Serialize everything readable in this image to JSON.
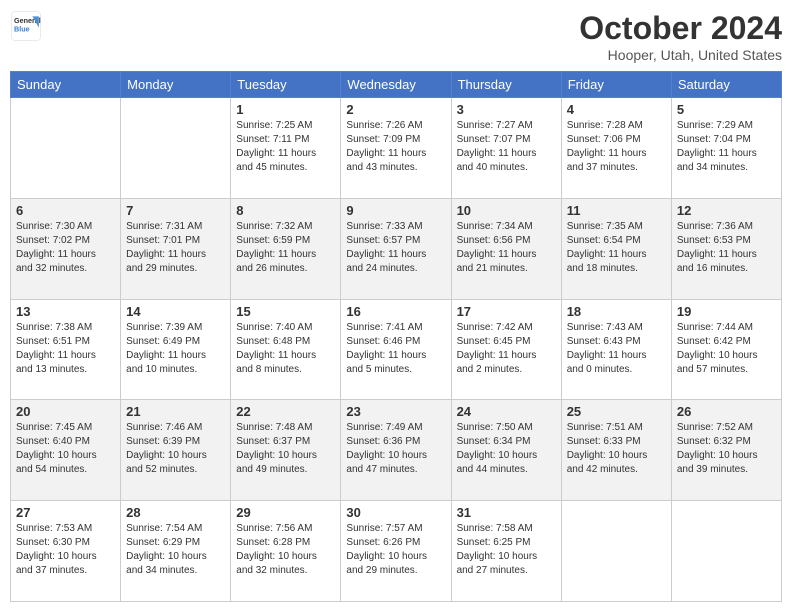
{
  "header": {
    "logo_line1": "General",
    "logo_line2": "Blue",
    "month": "October 2024",
    "location": "Hooper, Utah, United States"
  },
  "days_of_week": [
    "Sunday",
    "Monday",
    "Tuesday",
    "Wednesday",
    "Thursday",
    "Friday",
    "Saturday"
  ],
  "weeks": [
    [
      {
        "num": "",
        "info": ""
      },
      {
        "num": "",
        "info": ""
      },
      {
        "num": "1",
        "info": "Sunrise: 7:25 AM\nSunset: 7:11 PM\nDaylight: 11 hours and 45 minutes."
      },
      {
        "num": "2",
        "info": "Sunrise: 7:26 AM\nSunset: 7:09 PM\nDaylight: 11 hours and 43 minutes."
      },
      {
        "num": "3",
        "info": "Sunrise: 7:27 AM\nSunset: 7:07 PM\nDaylight: 11 hours and 40 minutes."
      },
      {
        "num": "4",
        "info": "Sunrise: 7:28 AM\nSunset: 7:06 PM\nDaylight: 11 hours and 37 minutes."
      },
      {
        "num": "5",
        "info": "Sunrise: 7:29 AM\nSunset: 7:04 PM\nDaylight: 11 hours and 34 minutes."
      }
    ],
    [
      {
        "num": "6",
        "info": "Sunrise: 7:30 AM\nSunset: 7:02 PM\nDaylight: 11 hours and 32 minutes."
      },
      {
        "num": "7",
        "info": "Sunrise: 7:31 AM\nSunset: 7:01 PM\nDaylight: 11 hours and 29 minutes."
      },
      {
        "num": "8",
        "info": "Sunrise: 7:32 AM\nSunset: 6:59 PM\nDaylight: 11 hours and 26 minutes."
      },
      {
        "num": "9",
        "info": "Sunrise: 7:33 AM\nSunset: 6:57 PM\nDaylight: 11 hours and 24 minutes."
      },
      {
        "num": "10",
        "info": "Sunrise: 7:34 AM\nSunset: 6:56 PM\nDaylight: 11 hours and 21 minutes."
      },
      {
        "num": "11",
        "info": "Sunrise: 7:35 AM\nSunset: 6:54 PM\nDaylight: 11 hours and 18 minutes."
      },
      {
        "num": "12",
        "info": "Sunrise: 7:36 AM\nSunset: 6:53 PM\nDaylight: 11 hours and 16 minutes."
      }
    ],
    [
      {
        "num": "13",
        "info": "Sunrise: 7:38 AM\nSunset: 6:51 PM\nDaylight: 11 hours and 13 minutes."
      },
      {
        "num": "14",
        "info": "Sunrise: 7:39 AM\nSunset: 6:49 PM\nDaylight: 11 hours and 10 minutes."
      },
      {
        "num": "15",
        "info": "Sunrise: 7:40 AM\nSunset: 6:48 PM\nDaylight: 11 hours and 8 minutes."
      },
      {
        "num": "16",
        "info": "Sunrise: 7:41 AM\nSunset: 6:46 PM\nDaylight: 11 hours and 5 minutes."
      },
      {
        "num": "17",
        "info": "Sunrise: 7:42 AM\nSunset: 6:45 PM\nDaylight: 11 hours and 2 minutes."
      },
      {
        "num": "18",
        "info": "Sunrise: 7:43 AM\nSunset: 6:43 PM\nDaylight: 11 hours and 0 minutes."
      },
      {
        "num": "19",
        "info": "Sunrise: 7:44 AM\nSunset: 6:42 PM\nDaylight: 10 hours and 57 minutes."
      }
    ],
    [
      {
        "num": "20",
        "info": "Sunrise: 7:45 AM\nSunset: 6:40 PM\nDaylight: 10 hours and 54 minutes."
      },
      {
        "num": "21",
        "info": "Sunrise: 7:46 AM\nSunset: 6:39 PM\nDaylight: 10 hours and 52 minutes."
      },
      {
        "num": "22",
        "info": "Sunrise: 7:48 AM\nSunset: 6:37 PM\nDaylight: 10 hours and 49 minutes."
      },
      {
        "num": "23",
        "info": "Sunrise: 7:49 AM\nSunset: 6:36 PM\nDaylight: 10 hours and 47 minutes."
      },
      {
        "num": "24",
        "info": "Sunrise: 7:50 AM\nSunset: 6:34 PM\nDaylight: 10 hours and 44 minutes."
      },
      {
        "num": "25",
        "info": "Sunrise: 7:51 AM\nSunset: 6:33 PM\nDaylight: 10 hours and 42 minutes."
      },
      {
        "num": "26",
        "info": "Sunrise: 7:52 AM\nSunset: 6:32 PM\nDaylight: 10 hours and 39 minutes."
      }
    ],
    [
      {
        "num": "27",
        "info": "Sunrise: 7:53 AM\nSunset: 6:30 PM\nDaylight: 10 hours and 37 minutes."
      },
      {
        "num": "28",
        "info": "Sunrise: 7:54 AM\nSunset: 6:29 PM\nDaylight: 10 hours and 34 minutes."
      },
      {
        "num": "29",
        "info": "Sunrise: 7:56 AM\nSunset: 6:28 PM\nDaylight: 10 hours and 32 minutes."
      },
      {
        "num": "30",
        "info": "Sunrise: 7:57 AM\nSunset: 6:26 PM\nDaylight: 10 hours and 29 minutes."
      },
      {
        "num": "31",
        "info": "Sunrise: 7:58 AM\nSunset: 6:25 PM\nDaylight: 10 hours and 27 minutes."
      },
      {
        "num": "",
        "info": ""
      },
      {
        "num": "",
        "info": ""
      }
    ]
  ]
}
